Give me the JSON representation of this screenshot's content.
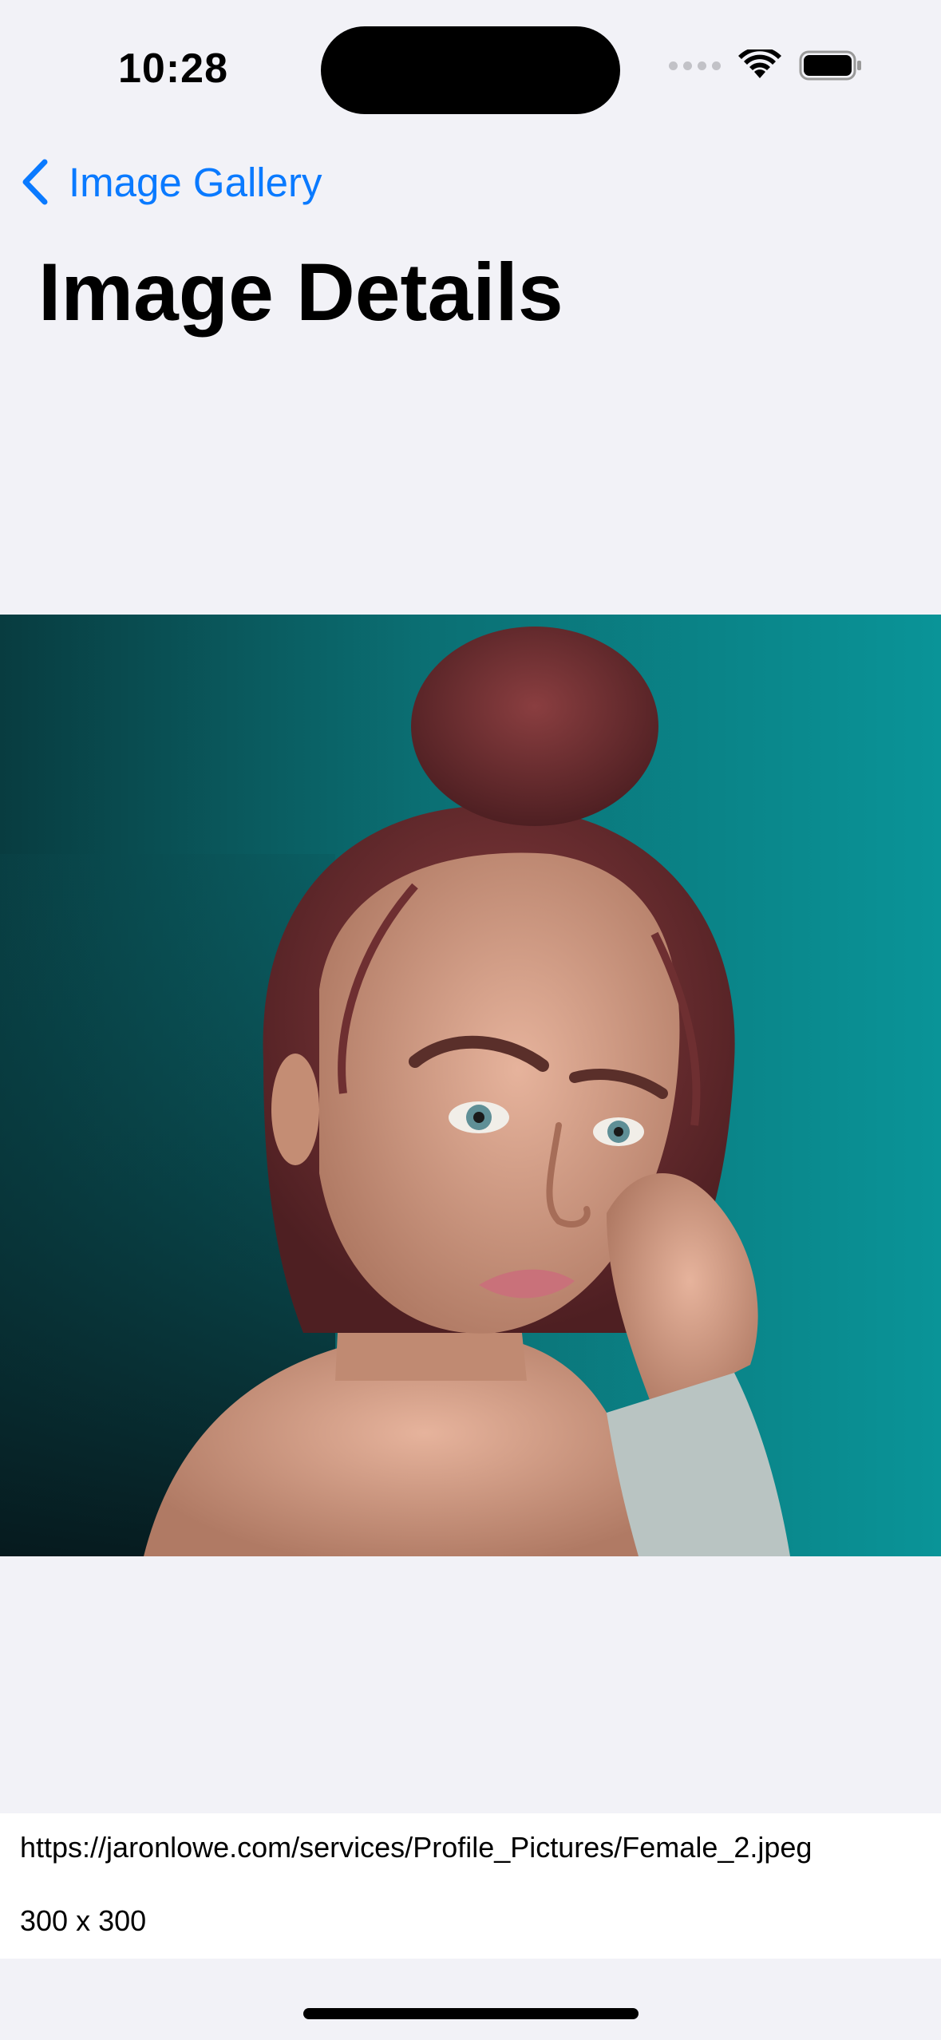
{
  "status_bar": {
    "time": "10:28",
    "icons": [
      "cellular-signal-icon",
      "wifi-icon",
      "battery-icon"
    ]
  },
  "nav": {
    "back_label": "Image Gallery",
    "back_icon": "chevron-left-icon",
    "title": "Image Details"
  },
  "image": {
    "icon": "portrait-photo",
    "description_colors": {
      "background": "#0b8a8f",
      "hair": "#7a3336",
      "skin": "#d9a28a",
      "sleeve": "#b9c4c2"
    }
  },
  "details": {
    "url": "https://jaronlowe.com/services/Profile_Pictures/Female_2.jpeg",
    "dimensions": "300 x 300"
  },
  "colors": {
    "accent": "#0a7aff",
    "background": "#f2f2f7",
    "card": "#ffffff"
  }
}
